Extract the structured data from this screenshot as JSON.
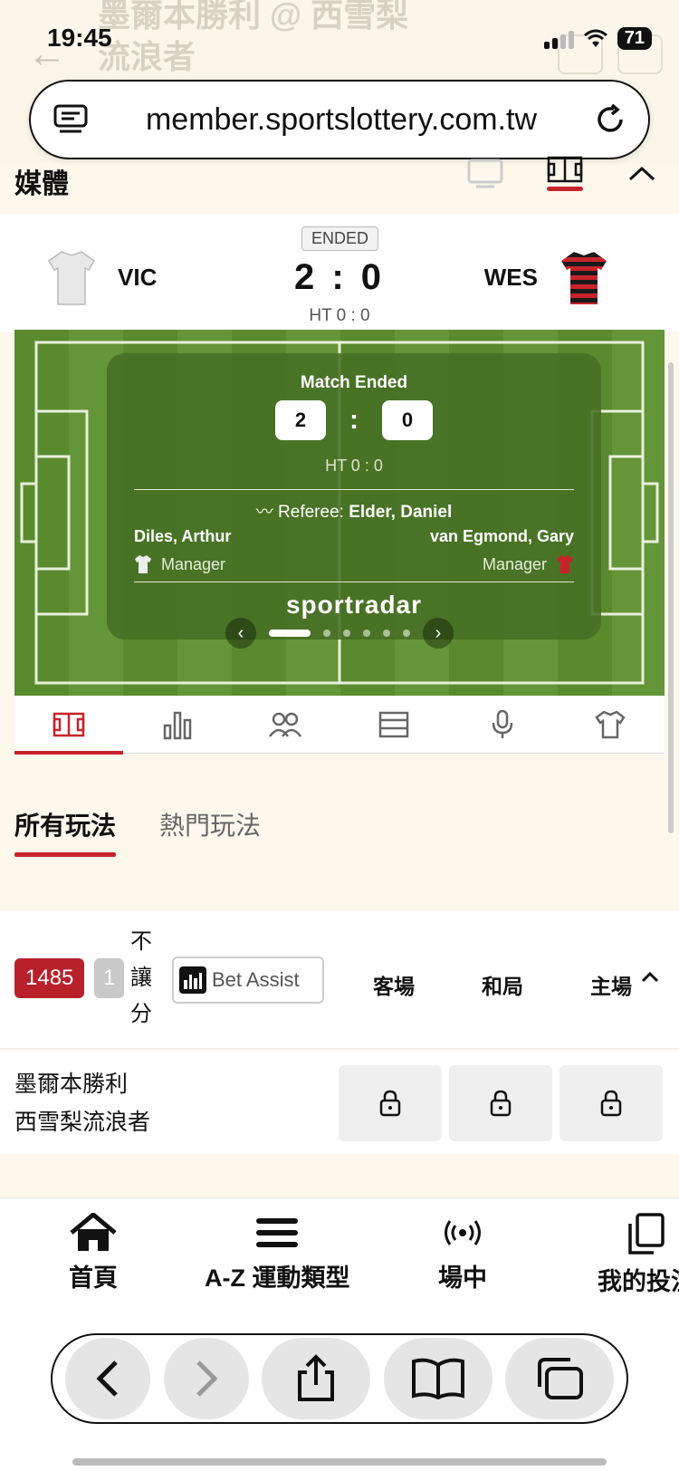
{
  "status_bar": {
    "time": "19:45",
    "battery": "71"
  },
  "ghost_title": "墨爾本勝利 @ 西雪梨 流浪者",
  "browser": {
    "url": "member.sportslottery.com.tw"
  },
  "media": {
    "label": "媒體"
  },
  "match": {
    "status": "ENDED",
    "home_code": "VIC",
    "away_code": "WES",
    "score": "2 : 0",
    "halftime": "HT 0 : 0"
  },
  "tracker": {
    "title": "Match Ended",
    "home_score": "2",
    "away_score": "0",
    "colon": ":",
    "halftime": "HT  0 : 0",
    "referee_label": "Referee:",
    "referee_name": "Elder, Daniel",
    "home_manager": "Diles, Arthur",
    "away_manager": "van Egmond, Gary",
    "manager_label": "Manager",
    "brand": "sportradar"
  },
  "bet_tabs": [
    {
      "label": "所有玩法"
    },
    {
      "label": "熱門玩法"
    }
  ],
  "market": {
    "count": "1485",
    "count_small": "1",
    "type": "不讓分",
    "bet_assist": "Bet Assist",
    "columns": [
      "客場",
      "和局",
      "主場"
    ],
    "row_home": "墨爾本勝利",
    "row_away": "西雪梨流浪者"
  },
  "bottom_nav": [
    {
      "label": "首頁",
      "icon": "home-icon"
    },
    {
      "label": "A-Z 運動類型",
      "icon": "menu-icon"
    },
    {
      "label": "場中",
      "icon": "live-icon"
    },
    {
      "label": "我的投注",
      "icon": "copy-icon"
    }
  ],
  "colors": {
    "accent": "#c8232c",
    "badge": "#b8202a",
    "pitch": "#5a8a2e"
  }
}
